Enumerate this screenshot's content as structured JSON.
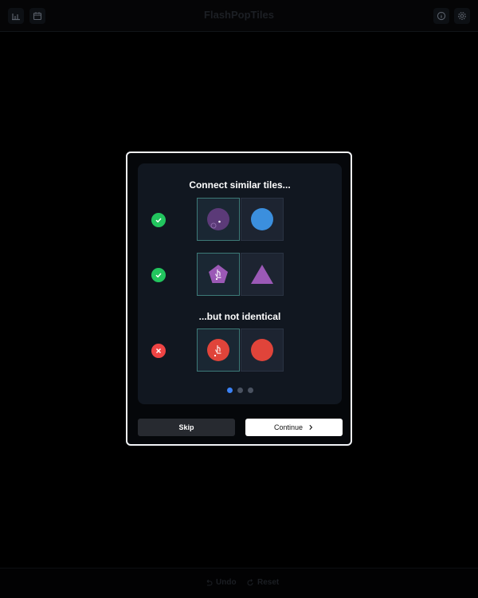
{
  "app": {
    "title": "FlashPopTiles"
  },
  "header": {
    "left_icons": [
      "bar-chart-icon",
      "calendar-icon"
    ],
    "right_icons": [
      "info-icon",
      "gear-icon"
    ]
  },
  "footer": {
    "undo_label": "Undo",
    "reset_label": "Reset"
  },
  "tutorial": {
    "heading_similar": "Connect similar tiles...",
    "heading_identical": "...but not identical",
    "rows": [
      {
        "status": "correct",
        "left_shape": "circle",
        "left_color": "#5b3a78",
        "right_shape": "circle",
        "right_color": "#3b8fde"
      },
      {
        "status": "correct",
        "left_shape": "pentagon",
        "left_color": "#9b59b6",
        "right_shape": "triangle",
        "right_color": "#9b59b6"
      },
      {
        "status": "wrong",
        "left_shape": "circle",
        "left_color": "#e0443a",
        "right_shape": "circle",
        "right_color": "#e0443a"
      }
    ],
    "page_count": 3,
    "current_page": 1
  },
  "buttons": {
    "skip_label": "Skip",
    "continue_label": "Continue"
  },
  "colors": {
    "accent": "#3b82f6",
    "correct": "#22c55e",
    "wrong": "#ef4444",
    "tile_selected_border": "#3d7a78"
  }
}
